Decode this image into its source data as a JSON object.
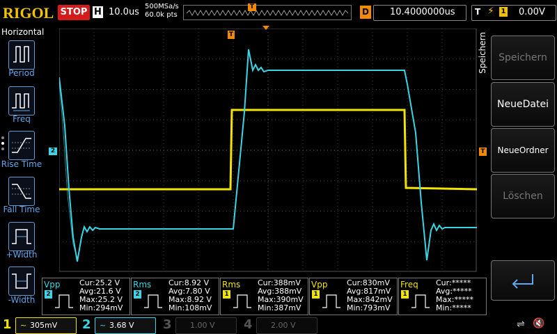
{
  "header": {
    "brand": "RIGOL",
    "run_state": "STOP",
    "horiz_badge": "H",
    "horiz_scale": "10.0us",
    "sample_rate": "500MSa/s",
    "mem_depth": "60.0k pts",
    "delay_badge": "D",
    "delay_value": "10.4000000us",
    "trigger_badge": "T",
    "trigger_source": "1",
    "trigger_level": "0.00V"
  },
  "left_menu": {
    "title": "Horizontal",
    "items": [
      {
        "label": "Period",
        "icon": "period-icon"
      },
      {
        "label": "Freq",
        "icon": "freq-icon"
      },
      {
        "label": "Rise Time",
        "icon": "rise-time-icon"
      },
      {
        "label": "Fall Time",
        "icon": "fall-time-icon"
      },
      {
        "label": "+Width",
        "icon": "positive-width-icon"
      },
      {
        "label": "-Width",
        "icon": "negative-width-icon"
      }
    ]
  },
  "right_menu": {
    "title": "Speichern",
    "buttons": [
      {
        "label": "Speichern",
        "enabled": false
      },
      {
        "label": "NeueDatei",
        "enabled": true
      },
      {
        "label": "NeueOrdner",
        "enabled": true
      },
      {
        "label": "Löschen",
        "enabled": false
      },
      {
        "label": "",
        "icon": "return-arrow-icon",
        "enabled": true
      }
    ]
  },
  "markers": {
    "ch2_marker": "2",
    "trigger_pos": "T",
    "trigger_level": "T"
  },
  "measurements": [
    {
      "name": "Vpp",
      "channel": "2",
      "color": "#3ad6e6",
      "cur": "Cur:25.2 V",
      "avg": "Avg:21.6 V",
      "max": "Max:25.2 V",
      "min": "Min:294mV"
    },
    {
      "name": "Rms",
      "channel": "2",
      "color": "#3ad6e6",
      "cur": "Cur:8.92 V",
      "avg": "Avg:7.80 V",
      "max": "Max:8.92 V",
      "min": "Min:108mV"
    },
    {
      "name": "Rms",
      "channel": "1",
      "color": "#f2e400",
      "cur": "Cur:388mV",
      "avg": "Avg:388mV",
      "max": "Max:390mV",
      "min": "Min:387mV"
    },
    {
      "name": "Vpp",
      "channel": "1",
      "color": "#f2e400",
      "cur": "Cur:830mV",
      "avg": "Avg:817mV",
      "max": "Max:842mV",
      "min": "Min:793mV"
    },
    {
      "name": "Freq",
      "channel": "1",
      "color": "#f2e400",
      "cur": "Cur:*****",
      "avg": "Avg:*****",
      "max": "Max:*****",
      "min": "Min:*****"
    }
  ],
  "channels": [
    {
      "num": "1",
      "scale": "305mV",
      "coupling": "~",
      "color": "#f2e400",
      "active": true
    },
    {
      "num": "2",
      "scale": "3.68 V",
      "coupling": "~",
      "color": "#3ad6e6",
      "active": true
    },
    {
      "num": "3",
      "scale": "1.00 V",
      "coupling": "",
      "color": "#c040c0",
      "active": false
    },
    {
      "num": "4",
      "scale": "2.00 V",
      "coupling": "",
      "color": "#4060e0",
      "active": false
    }
  ],
  "colors": {
    "ch1": "#f2e400",
    "ch2": "#3ad6e6",
    "trigger": "#f28a00",
    "stop": "#d41c1c"
  }
}
